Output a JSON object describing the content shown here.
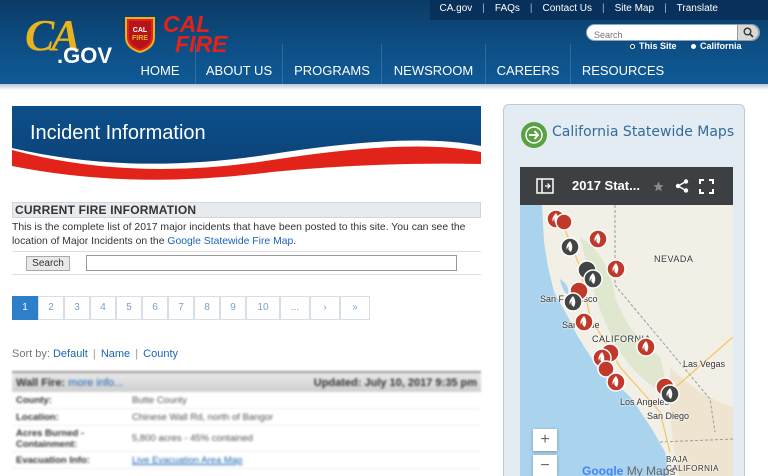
{
  "header": {
    "logo_ca": "CA",
    "logo_gov": ".GOV",
    "calfire_line1": "CAL",
    "calfire_line2": "FIRE",
    "shield_text_top": "CAL",
    "shield_text_mid": "FIRE",
    "utility_links": [
      "CA.gov",
      "FAQs",
      "Contact Us",
      "Site Map",
      "Translate"
    ],
    "search_placeholder": "Search",
    "scope_this_site": "This Site",
    "scope_california": "California",
    "nav": [
      "HOME",
      "ABOUT US",
      "PROGRAMS",
      "NEWSROOM",
      "CAREERS",
      "RESOURCES"
    ]
  },
  "banner": {
    "title": "Incident Information"
  },
  "current": {
    "heading": "CURRENT FIRE INFORMATION",
    "desc_part1": "This is the complete list of 2017 major incidents that have been posted to this site. You can see the location of Major Incidents on the ",
    "desc_link": "Google Statewide Fire Map",
    "desc_part2": ".",
    "search_button": "Search"
  },
  "pager": [
    "1",
    "2",
    "3",
    "4",
    "5",
    "6",
    "7",
    "8",
    "9",
    "10",
    "...",
    "›",
    "»"
  ],
  "sort": {
    "label": "Sort by:",
    "options": [
      "Default",
      "Name",
      "County"
    ]
  },
  "incident": {
    "name": "Wall Fire:",
    "more": "more info...",
    "updated": "Updated: July 10, 2017 9:35 pm",
    "rows": [
      {
        "k": "County:",
        "v": "Butte County"
      },
      {
        "k": "Location:",
        "v": "Chinese Wall Rd, north of Bangor"
      },
      {
        "k": "Acres Burned - Containment:",
        "v": "5,800 acres - 45% contained"
      },
      {
        "k": "Evacuation Info:",
        "v": "Live Evacuation Area Map"
      }
    ]
  },
  "sidebar": {
    "title": "California Statewide Maps",
    "map": {
      "title": "2017 Stat...",
      "labels": [
        "NEVADA",
        "San Francisco",
        "San Jose",
        "CALIFORNIA",
        "Las Vegas",
        "Los Angeles",
        "San Diego",
        "BAJA CALIFORNIA"
      ],
      "zoom_in": "+",
      "zoom_out": "−",
      "google": "Google",
      "mymaps": "My Maps"
    }
  },
  "colors": {
    "header_blue": "#0d4e84",
    "fire_red": "#e2231a",
    "gov_gold": "#e9b21f",
    "link": "#1b64b4",
    "pager_active": "#2d7fc9"
  }
}
